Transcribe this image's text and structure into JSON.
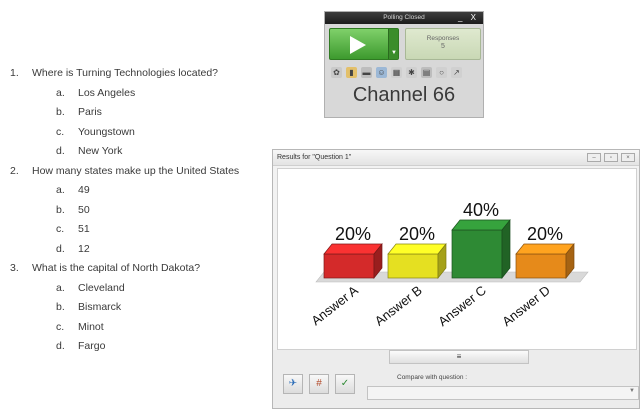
{
  "questions": [
    {
      "number": "1.",
      "text": "Where is Turning Technologies located?",
      "answers": [
        {
          "letter": "a.",
          "text": "Los Angeles"
        },
        {
          "letter": "b.",
          "text": "Paris"
        },
        {
          "letter": "c.",
          "text": "Youngstown"
        },
        {
          "letter": "d.",
          "text": "New York"
        }
      ]
    },
    {
      "number": "2.",
      "text": "How many states make up the United States",
      "answers": [
        {
          "letter": "a.",
          "text": "49"
        },
        {
          "letter": "b.",
          "text": "50"
        },
        {
          "letter": "c.",
          "text": "51"
        },
        {
          "letter": "d.",
          "text": "12"
        }
      ]
    },
    {
      "number": "3.",
      "text": "What is the capital of North Dakota?",
      "answers": [
        {
          "letter": "a.",
          "text": "Cleveland"
        },
        {
          "letter": "b.",
          "text": "Bismarck"
        },
        {
          "letter": "c.",
          "text": "Minot"
        },
        {
          "letter": "d.",
          "text": "Fargo"
        }
      ]
    }
  ],
  "polling": {
    "title": "Polling Closed",
    "window_controls": "_ X",
    "responses_label": "Responses",
    "responses_value": "5",
    "channel": "Channel 66",
    "icons": [
      "star-icon",
      "chart-icon",
      "monitor-icon",
      "people-icon",
      "grid-icon",
      "gear-icon",
      "print-icon",
      "chat-icon",
      "export-icon"
    ]
  },
  "results": {
    "title": "Results for \"Question 1\"",
    "expander_glyph": "≡",
    "compare_label": "Compare with question :",
    "tools": [
      "pin-icon",
      "ranking-icon",
      "correct-icon"
    ]
  },
  "chart_data": {
    "type": "bar",
    "categories": [
      "Answer A",
      "Answer B",
      "Answer C",
      "Answer D"
    ],
    "values": [
      20,
      20,
      40,
      20
    ],
    "labels": [
      "20%",
      "20%",
      "40%",
      "20%"
    ],
    "colors": [
      "#d42a2a",
      "#e5e021",
      "#2e8a34",
      "#e68a1a"
    ],
    "title": "",
    "xlabel": "",
    "ylabel": "",
    "ylim": [
      0,
      40
    ],
    "grid": false,
    "style": "3d"
  }
}
